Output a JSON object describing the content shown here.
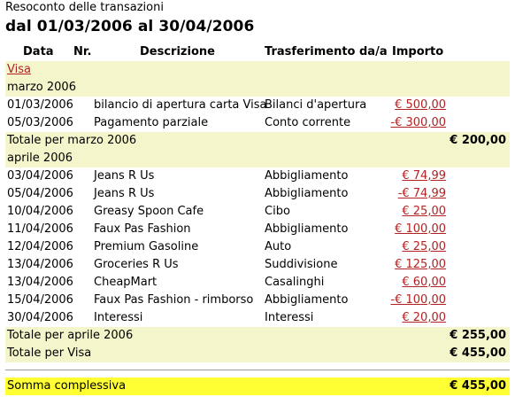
{
  "report": {
    "title": "Resoconto delle transazioni",
    "range": "dal 01/03/2006 al 30/04/2006"
  },
  "columns": {
    "date": "Data",
    "num": "Nr.",
    "desc": "Descrizione",
    "xfer": "Trasferimento da/a",
    "amount": "Importo"
  },
  "account": {
    "name": "Visa",
    "total_label": "Totale per Visa",
    "total_value": "€ 455,00"
  },
  "months": [
    {
      "label": "marzo 2006",
      "total_label": "Totale per marzo 2006",
      "total_value": "€ 200,00",
      "rows": [
        {
          "date": "01/03/2006",
          "desc": "bilancio di apertura carta Visa",
          "xfer": "Bilanci d'apertura",
          "amount": "€ 500,00"
        },
        {
          "date": "05/03/2006",
          "desc": "Pagamento parziale",
          "xfer": "Conto corrente",
          "amount": "-€ 300,00"
        }
      ]
    },
    {
      "label": "aprile 2006",
      "total_label": "Totale per aprile 2006",
      "total_value": "€ 255,00",
      "rows": [
        {
          "date": "03/04/2006",
          "desc": "Jeans R Us",
          "xfer": "Abbigliamento",
          "amount": "€ 74,99"
        },
        {
          "date": "05/04/2006",
          "desc": "Jeans R Us",
          "xfer": "Abbigliamento",
          "amount": "-€ 74,99"
        },
        {
          "date": "10/04/2006",
          "desc": "Greasy Spoon Cafe",
          "xfer": "Cibo",
          "amount": "€ 25,00"
        },
        {
          "date": "11/04/2006",
          "desc": "Faux Pas Fashion",
          "xfer": "Abbigliamento",
          "amount": "€ 100,00"
        },
        {
          "date": "12/04/2006",
          "desc": "Premium Gasoline",
          "xfer": "Auto",
          "amount": "€ 25,00"
        },
        {
          "date": "13/04/2006",
          "desc": "Groceries R Us",
          "xfer": "Suddivisione",
          "amount": "€ 125,00"
        },
        {
          "date": "13/04/2006",
          "desc": "CheapMart",
          "xfer": "Casalinghi",
          "amount": "€ 60,00"
        },
        {
          "date": "15/04/2006",
          "desc": "Faux Pas Fashion - rimborso",
          "xfer": "Abbigliamento",
          "amount": "-€ 100,00"
        },
        {
          "date": "30/04/2006",
          "desc": "Interessi",
          "xfer": "Interessi",
          "amount": "€ 20,00"
        }
      ]
    }
  ],
  "grand_total": {
    "label": "Somma complessiva",
    "value": "€ 455,00"
  },
  "colors": {
    "link": "#b22222",
    "section_bg": "#f5f5cc",
    "grand_bg": "#ffff33"
  }
}
